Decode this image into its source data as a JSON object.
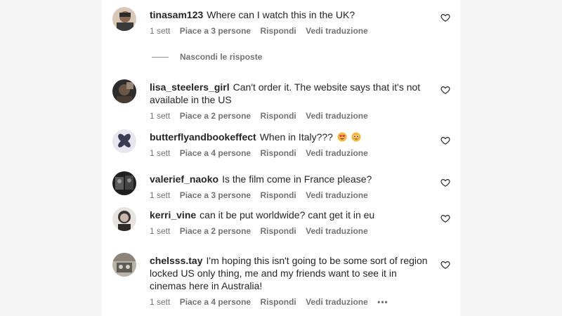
{
  "comments": [
    {
      "username": "tinasam123",
      "text": "Where can I watch this in the UK?",
      "time": "1 sett",
      "likes": "Piace a 3 persone",
      "reply": "Rispondi",
      "translate": "Vedi traduzione"
    },
    {
      "username": "lisa_steelers_girl",
      "text": "Can't order it. The website says that it's not available in the US",
      "time": "1 sett",
      "likes": "Piace a 2 persone",
      "reply": "Rispondi",
      "translate": "Vedi traduzione"
    },
    {
      "username": "butterflyandbookeffect",
      "text": "When in Italy???",
      "emojis": [
        "heart-eyes-emoji",
        "pleading-face-emoji"
      ],
      "time": "1 sett",
      "likes": "Piace a 4 persone",
      "reply": "Rispondi",
      "translate": "Vedi traduzione"
    },
    {
      "username": "valerief_naoko",
      "text": "Is the film come in France please?",
      "time": "1 sett",
      "likes": "Piace a 3 persone",
      "reply": "Rispondi",
      "translate": "Vedi traduzione"
    },
    {
      "username": "kerri_vine",
      "text": "can it be put worldwide? cant get it in eu",
      "time": "1 sett",
      "likes": "Piace a 2 persone",
      "reply": "Rispondi",
      "translate": "Vedi traduzione"
    },
    {
      "username": "chelsss.tay",
      "text": "I'm hoping this isn't going to be some sort of region locked US only thing, me and my friends want to see it in cinemas here in Australia!",
      "time": "1 sett",
      "likes": "Piace a 4 persone",
      "reply": "Rispondi",
      "translate": "Vedi traduzione",
      "more": "•••"
    }
  ],
  "hide_replies": "Nascondi le risposte",
  "icons": {
    "like": "heart-outline-icon"
  }
}
